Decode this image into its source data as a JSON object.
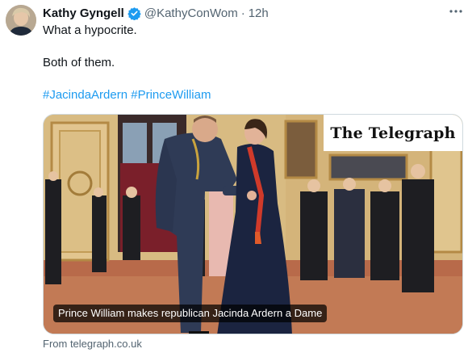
{
  "author": {
    "display_name": "Kathy Gyngell",
    "handle": "@KathyConWom",
    "separator": "·",
    "timestamp": "12h"
  },
  "tweet": {
    "line1": "What a hypocrite.",
    "line2": "Both of them.",
    "hashtags": [
      "#JacindaArdern",
      "#PrinceWilliam"
    ]
  },
  "card": {
    "publisher_logo": "The Telegraph",
    "caption": "Prince William makes republican Jacinda Ardern a Dame",
    "source_label": "From telegraph.co.uk"
  },
  "icons": {
    "verified": "verified-badge-icon",
    "more": "more-options-icon"
  },
  "colors": {
    "link": "#1d9bf0",
    "verified": "#1d9bf0",
    "secondary_text": "#536471"
  }
}
